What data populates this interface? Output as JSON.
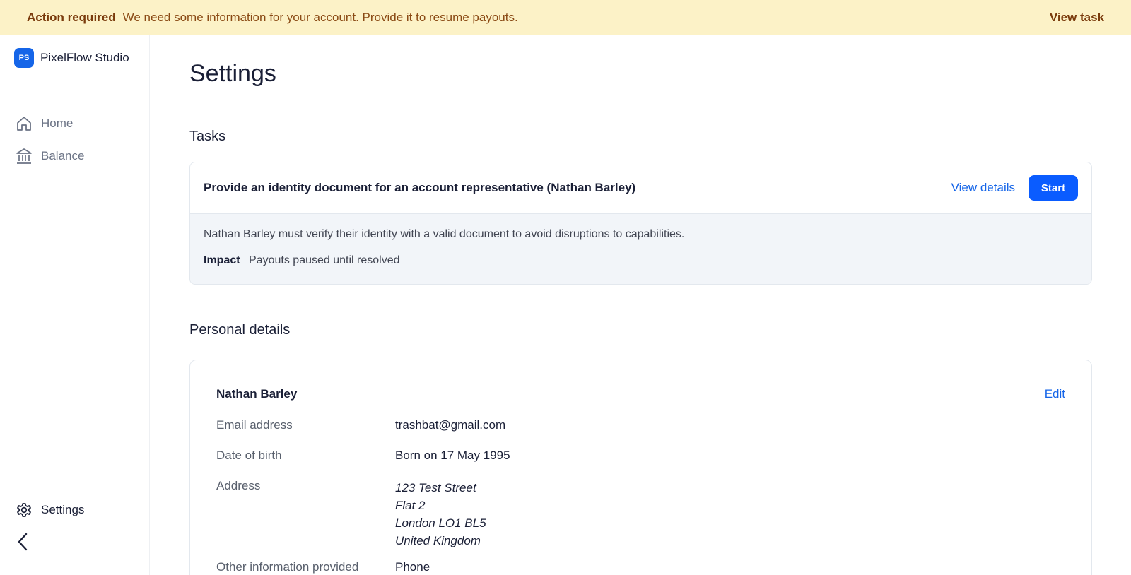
{
  "banner": {
    "label": "Action required",
    "message": "We need some information for your account. Provide it to resume payouts.",
    "link": "View task"
  },
  "brand": {
    "initials": "PS",
    "name": "PixelFlow Studio"
  },
  "nav": {
    "home": "Home",
    "balance": "Balance",
    "settings": "Settings"
  },
  "page": {
    "title": "Settings"
  },
  "tasks": {
    "section_title": "Tasks",
    "item": {
      "title": "Provide an identity document for an account representative (Nathan Barley)",
      "view_details": "View details",
      "start": "Start",
      "description": "Nathan Barley must verify their identity with a valid document to avoid disruptions to capabilities.",
      "impact_label": "Impact",
      "impact_value": "Payouts paused until resolved"
    }
  },
  "personal": {
    "section_title": "Personal details",
    "name": "Nathan Barley",
    "edit": "Edit",
    "rows": {
      "email": {
        "label": "Email address",
        "value": "trashbat@gmail.com"
      },
      "dob": {
        "label": "Date of birth",
        "value": "Born on 17 May 1995"
      },
      "address": {
        "label": "Address",
        "lines": [
          "123 Test Street",
          "Flat 2",
          "London LO1 BL5",
          "United Kingdom"
        ]
      },
      "other": {
        "label": "Other information provided",
        "value": "Phone"
      }
    }
  },
  "colors": {
    "banner_bg": "#fcf2c7",
    "accent": "#0a5cff",
    "link": "#1565e8"
  },
  "icons": {
    "home": "home-icon",
    "balance": "bank-icon",
    "settings": "gear-icon",
    "collapse": "chevron-left-icon"
  }
}
